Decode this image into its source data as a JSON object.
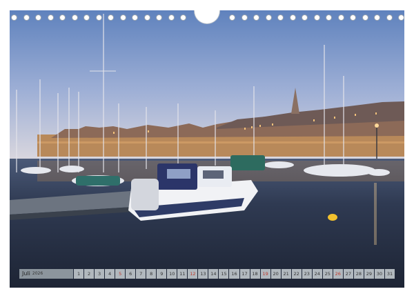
{
  "calendar": {
    "month": "Juli",
    "year": "2026",
    "days": [
      {
        "label": "1",
        "sunday": false
      },
      {
        "label": "2",
        "sunday": false
      },
      {
        "label": "3",
        "sunday": false
      },
      {
        "label": "4",
        "sunday": false
      },
      {
        "label": "5",
        "sunday": true
      },
      {
        "label": "6",
        "sunday": false
      },
      {
        "label": "7",
        "sunday": false
      },
      {
        "label": "8",
        "sunday": false
      },
      {
        "label": "9",
        "sunday": false
      },
      {
        "label": "10",
        "sunday": false
      },
      {
        "label": "11",
        "sunday": false
      },
      {
        "label": "12",
        "sunday": true
      },
      {
        "label": "13",
        "sunday": false
      },
      {
        "label": "14",
        "sunday": false
      },
      {
        "label": "15",
        "sunday": false
      },
      {
        "label": "16",
        "sunday": false
      },
      {
        "label": "17",
        "sunday": false
      },
      {
        "label": "18",
        "sunday": false
      },
      {
        "label": "19",
        "sunday": true
      },
      {
        "label": "20",
        "sunday": false
      },
      {
        "label": "21",
        "sunday": false
      },
      {
        "label": "22",
        "sunday": false
      },
      {
        "label": "23",
        "sunday": false
      },
      {
        "label": "24",
        "sunday": false
      },
      {
        "label": "25",
        "sunday": false
      },
      {
        "label": "26",
        "sunday": true
      },
      {
        "label": "27",
        "sunday": false
      },
      {
        "label": "28",
        "sunday": false
      },
      {
        "label": "29",
        "sunday": false
      },
      {
        "label": "30",
        "sunday": false
      },
      {
        "label": "31",
        "sunday": false
      }
    ]
  },
  "colors": {
    "sky_top": "#6f8fc4",
    "sky_bottom": "#c9cfe0",
    "water": "#2a3347",
    "town_wall": "#b88a5a",
    "sunday": "#c0392b"
  }
}
